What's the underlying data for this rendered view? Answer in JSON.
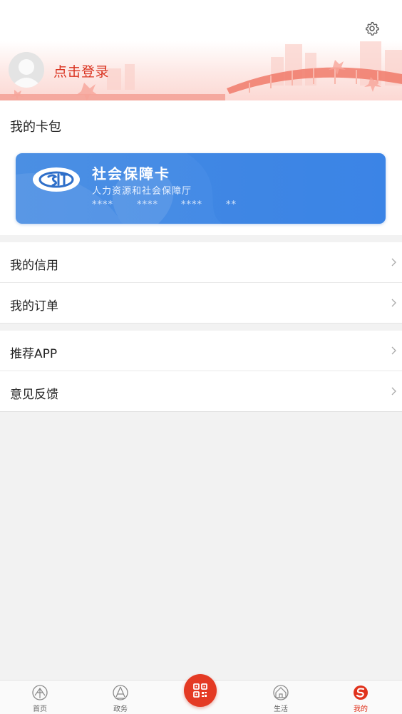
{
  "header": {
    "login_label": "点击登录"
  },
  "wallet": {
    "title": "我的卡包",
    "card": {
      "name": "社会保障卡",
      "issuer": "人力资源和社会保障厅",
      "number_masked": [
        "****",
        "****",
        "****",
        "**"
      ]
    }
  },
  "menu": {
    "group1": [
      {
        "label": "我的信用"
      },
      {
        "label": "我的订单"
      }
    ],
    "group2": [
      {
        "label": "推荐APP"
      },
      {
        "label": "意见反馈"
      }
    ]
  },
  "bottom_nav": {
    "items": [
      {
        "label": "首页",
        "icon": "home-icon",
        "active": false
      },
      {
        "label": "政务",
        "icon": "government-icon",
        "active": false
      },
      {
        "label": "生活",
        "icon": "life-icon",
        "active": false
      },
      {
        "label": "我的",
        "icon": "mine-icon",
        "active": true
      }
    ],
    "center": {
      "icon": "qr-scan-icon"
    }
  },
  "colors": {
    "accent": "#e43a24",
    "login_text": "#d9321f",
    "card_blue": "#4289e6",
    "background": "#f2f2f2"
  }
}
